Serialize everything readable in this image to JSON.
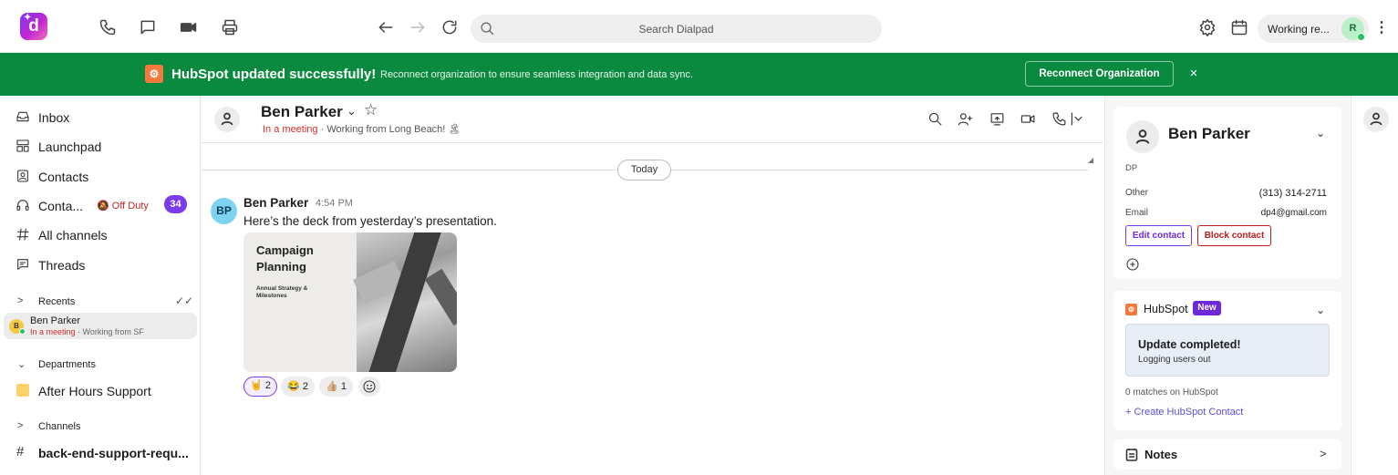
{
  "topbar": {
    "search_placeholder": "Search Dialpad",
    "status_label": "Working re...",
    "user_initial": "R",
    "logo_letter": "d",
    "icons": [
      "phone-icon",
      "chat-icon",
      "video-icon",
      "printer-icon",
      "arrow-left-icon",
      "arrow-right-icon",
      "refresh-icon",
      "search-icon",
      "gear-icon",
      "calendar-icon",
      "more-icon"
    ]
  },
  "banner": {
    "title": "HubSpot updated successfully!",
    "message": "Reconnect organization to ensure seamless integration and data sync.",
    "button": "Reconnect Organization",
    "close": "×",
    "color": "#0a8a3e"
  },
  "sidebar": {
    "items": [
      {
        "label": "Inbox",
        "icon": "inbox-icon"
      },
      {
        "label": "Launchpad",
        "icon": "launchpad-icon"
      },
      {
        "label": "Contacts",
        "icon": "contacts-icon"
      },
      {
        "label": "Conta...",
        "icon": "headset-icon",
        "status": "Off Duty",
        "badge": "34"
      },
      {
        "label": "All channels",
        "icon": "hash-icon"
      },
      {
        "label": "Threads",
        "icon": "threads-icon"
      }
    ],
    "recents": {
      "label": "Recents",
      "item": {
        "initial": "B",
        "name": "Ben Parker",
        "status": "In a meeting",
        "detail": "· Working from SF"
      }
    },
    "departments": {
      "label": "Departments",
      "item": "After Hours Support"
    },
    "channels": {
      "label": "Channels",
      "item": "back-end-support-requ..."
    }
  },
  "conversation": {
    "header": {
      "name": "Ben Parker",
      "status": "In a meeting",
      "detail": "· Working from Long Beach! 🏝"
    },
    "day_divider": "Today",
    "message": {
      "initials": "BP",
      "author": "Ben Parker",
      "time": "4:54 PM",
      "text": "Here’s the deck from yesterday’s presentation.",
      "attachment": {
        "title": "Campaign Planning",
        "subtitle": "Annual Strategy & Milestones"
      },
      "reactions": [
        {
          "emoji": "🤘",
          "count": "2",
          "active": true
        },
        {
          "emoji": "😂",
          "count": "2",
          "active": false
        },
        {
          "emoji": "👍🏼",
          "count": "1",
          "active": false
        }
      ]
    }
  },
  "contact_panel": {
    "name": "Ben Parker",
    "initials_label": "DP",
    "fields": [
      {
        "key": "Other",
        "value": "(313) 314-2711"
      },
      {
        "key": "Email",
        "value": "dp4@gmail.com"
      }
    ],
    "edit_button": "Edit contact",
    "block_button": "Block contact"
  },
  "hubspot_panel": {
    "title": "HubSpot",
    "badge": "New",
    "update_title": "Update completed!",
    "update_sub": "Logging users out",
    "matches": "0 matches on HubSpot",
    "create_link": "+ Create HubSpot Contact"
  },
  "notes_panel": {
    "title": "Notes"
  },
  "colors": {
    "accent": "#7c3aed",
    "danger": "#d32f2f",
    "banner": "#0a8a3e",
    "hubspot": "#f5793b"
  }
}
